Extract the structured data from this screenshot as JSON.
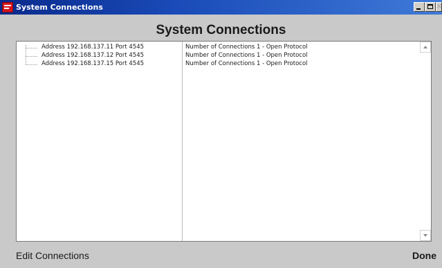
{
  "window": {
    "title": "System Connections",
    "controls": {
      "minimize": "minimize-icon",
      "maximize": "maximize-icon",
      "close": "close-icon"
    }
  },
  "heading": "System Connections",
  "connections": [
    {
      "address": "Address 192.168.137.11 Port 4545",
      "status": "Number of Connections 1 - Open Protocol"
    },
    {
      "address": "Address 192.168.137.12 Port 4545",
      "status": "Number of Connections 1 - Open Protocol"
    },
    {
      "address": "Address 192.168.137.15 Port 4545",
      "status": "Number of Connections 1 - Open Protocol"
    }
  ],
  "footer": {
    "edit_label": "Edit Connections",
    "done_label": "Done"
  },
  "colors": {
    "titlebar": "#0a2a8c",
    "window_bg": "#c9c9c9",
    "panel_bg": "#ffffff",
    "app_icon": "#d8141c"
  }
}
